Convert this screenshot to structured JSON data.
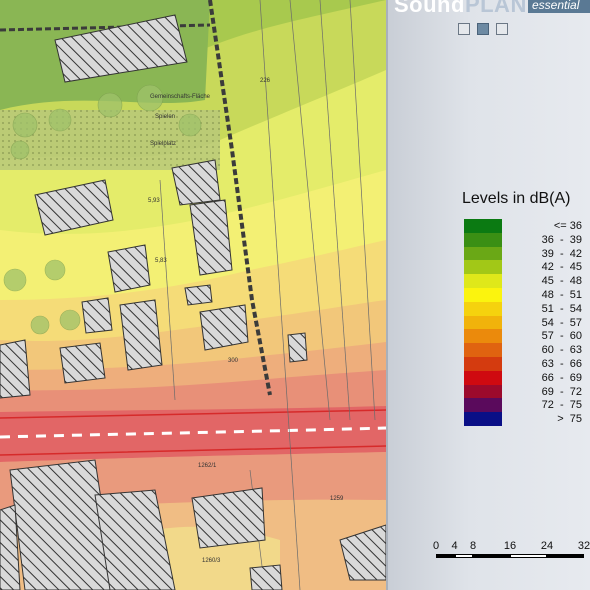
{
  "header": {
    "brand_part1": "Sound",
    "brand_part2": "PLAN",
    "edition": "essential",
    "page_indicators": [
      "page-1",
      "page-2",
      "page-3"
    ],
    "active_page": 1
  },
  "legend": {
    "title": "Levels in dB(A)",
    "items": [
      {
        "label": "<= 36",
        "color": "#0b7a12"
      },
      {
        "label": "36  -  39",
        "color": "#3a8f14"
      },
      {
        "label": "39  -  42",
        "color": "#6aa816"
      },
      {
        "label": "42  -  45",
        "color": "#a2c817"
      },
      {
        "label": "45  -  48",
        "color": "#dfe81a"
      },
      {
        "label": "48  -  51",
        "color": "#fbf40e"
      },
      {
        "label": "51  -  54",
        "color": "#f5d20e"
      },
      {
        "label": "54  -  57",
        "color": "#f1b30b"
      },
      {
        "label": "57  -  60",
        "color": "#eb8a0c"
      },
      {
        "label": "60  -  63",
        "color": "#e06310"
      },
      {
        "label": "63  -  66",
        "color": "#d43b0f"
      },
      {
        "label": "66  -  69",
        "color": "#cf0a10"
      },
      {
        "label": "69  -  72",
        "color": "#9c0a2c"
      },
      {
        "label": "72  -  75",
        "color": "#5a0a5c"
      },
      {
        "label": ">  75",
        "color": "#0a0f86"
      }
    ]
  },
  "scale_bar": {
    "ticks": [
      "0",
      "4",
      "8",
      "16",
      "24",
      "32"
    ]
  },
  "map": {
    "parcel_labels": [
      "Spielen",
      "Gemeinschafts-Fläche",
      "Spielplatz",
      "5,93",
      "5,83",
      "300",
      "1262/1",
      "1260/3",
      "1259",
      "226"
    ],
    "colors": {
      "building_fill": "#d8d8d8",
      "road_red": "#e0352f",
      "boundary": "#3b3b3b"
    }
  }
}
